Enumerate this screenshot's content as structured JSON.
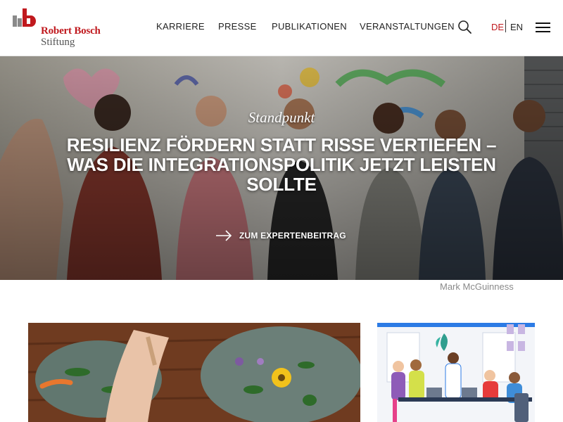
{
  "brand": {
    "name_line1": "Robert Bosch",
    "name_line2": "Stiftung",
    "color": "#c0191e"
  },
  "nav": {
    "items": [
      "KARRIERE",
      "PRESSE",
      "PUBLIKATIONEN",
      "VERANSTALTUNGEN"
    ],
    "search_icon": "search-icon",
    "languages": {
      "active": "DE",
      "other": "EN"
    },
    "menu_icon": "hamburger-menu-icon"
  },
  "hero": {
    "kicker": "Standpunkt",
    "title": "Resilienz fördern statt Risse vertiefen – was die Integrationspolitik jetzt leisten sollte",
    "cta": "ZUM EXPERTENBEITRAG",
    "cta_icon": "arrow-right-icon",
    "photo_credit": "Mark McGuinness"
  },
  "teasers": [
    {
      "image": "herbs-on-leaves-photo"
    },
    {
      "image": "office-team-illustration"
    }
  ]
}
